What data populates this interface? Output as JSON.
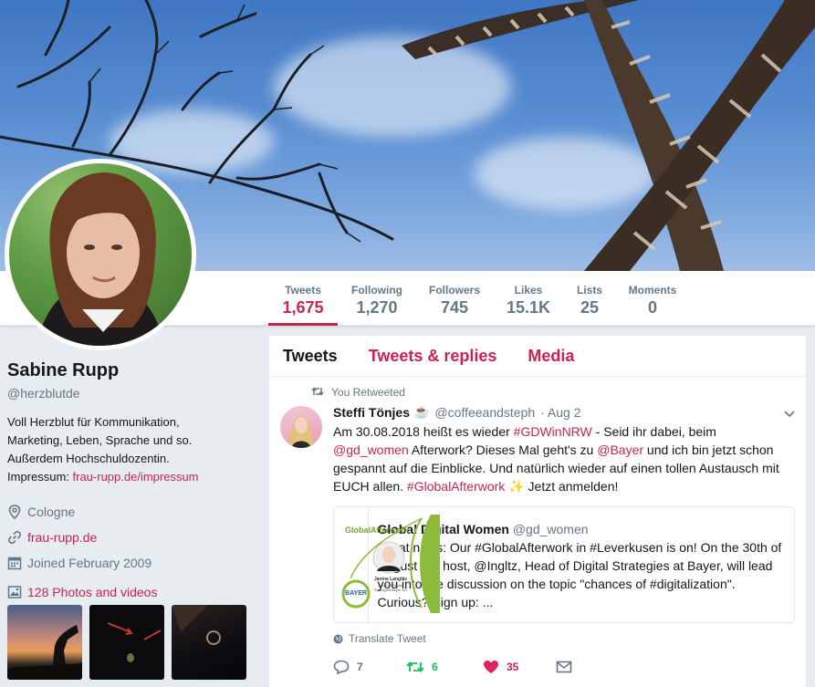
{
  "profile": {
    "name": "Sabine Rupp",
    "handle": "@herzblutde",
    "bio_lines": [
      "Voll Herzblut für Kommunikation,",
      "Marketing, Leben, Sprache und so.",
      "Außerdem Hochschuldozentin."
    ],
    "bio_impressum_label": "Impressum: ",
    "bio_impressum_link": "frau-rupp.de/impressum",
    "location": "Cologne",
    "website": "frau-rupp.de",
    "joined": "Joined February 2009",
    "photos_label": "128 Photos and videos"
  },
  "nav": [
    {
      "label": "Tweets",
      "value": "1,675"
    },
    {
      "label": "Following",
      "value": "1,270"
    },
    {
      "label": "Followers",
      "value": "745"
    },
    {
      "label": "Likes",
      "value": "15.1K"
    },
    {
      "label": "Lists",
      "value": "25"
    },
    {
      "label": "Moments",
      "value": "0"
    }
  ],
  "timeline": {
    "tabs": [
      "Tweets",
      "Tweets & replies",
      "Media"
    ]
  },
  "tweet": {
    "context": "You Retweeted",
    "author": "Steffi Tönjes",
    "author_emoji": "☕",
    "author_handle": "@coffeeandsteph",
    "date": "· Aug 2",
    "text": {
      "p1": "Am 30.08.2018 heißt es wieder ",
      "h1": "#GDWinNRW",
      "p2": " - Seid ihr dabei, beim ",
      "h2": "@gd_women",
      "p3": " Afterwork? Dieses Mal geht's zu ",
      "h3": "@Bayer",
      "p4": " und ich bin jetzt schon gespannt auf die Einblicke. Und natürlich wieder auf einen tollen Austausch mit EUCH allen. ",
      "h4": "#GlobalAfterwork",
      "sparkle": "✨",
      "p5": " Jetzt anmelden!"
    },
    "card": {
      "name": "Global Digital Women",
      "handle": "@gd_women",
      "text": "Great news: Our #GlobalAfterwork in #Leverkusen is on! On the 30th of August our host, @Ingltz, Head of Digital Strategies at Bayer, will lead you into the discussion on the topic \"chances of #digitalization\". Curious? Sign up: ...",
      "img_title": "GlobalAfterwork",
      "img_person": "Janine Langlitz",
      "img_role": "Head of Digital Strategies Bayer AG",
      "img_logo": "BAYER"
    },
    "translate_label": "Translate Tweet",
    "replies": "7",
    "retweets": "6",
    "likes": "35"
  },
  "colors": {
    "accent": "#c7254e",
    "retweet": "#17bf63",
    "muted": "#657786"
  }
}
